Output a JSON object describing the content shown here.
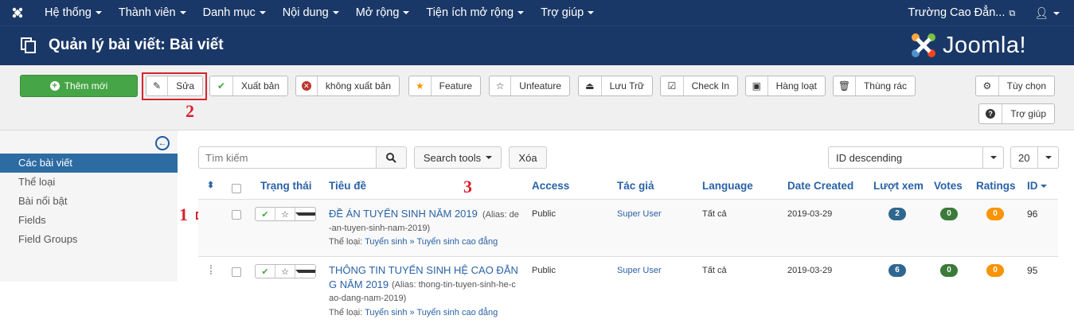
{
  "topbar": {
    "menu": [
      "Hệ thống",
      "Thành viên",
      "Danh mục",
      "Nội dung",
      "Mở rộng",
      "Tiện ích mở rộng",
      "Trợ giúp"
    ],
    "site_name": "Trường Cao Đẳn...",
    "user_icon": "user-icon"
  },
  "header": {
    "title": "Quản lý bài viết: Bài viết",
    "brand": "Joomla!"
  },
  "toolbar": {
    "new_label": "Thêm mới",
    "edit_label": "Sửa",
    "publish_label": "Xuất bản",
    "unpublish_label": "không xuất bản",
    "feature_label": "Feature",
    "unfeature_label": "Unfeature",
    "archive_label": "Lưu Trữ",
    "checkin_label": "Check In",
    "batch_label": "Hàng loạt",
    "trash_label": "Thùng rác",
    "options_label": "Tùy chọn",
    "help_label": "Trợ giúp"
  },
  "annotations": [
    "1",
    "2",
    "3"
  ],
  "sidebar": {
    "items": [
      "Các bài viết",
      "Thể loại",
      "Bài nổi bật",
      "Fields",
      "Field Groups"
    ]
  },
  "filters": {
    "search_placeholder": "Tìm kiếm",
    "search_tools_label": "Search tools",
    "clear_label": "Xóa",
    "ordering": "ID descending",
    "limit": "20"
  },
  "table": {
    "headers": {
      "status": "Trạng thái",
      "title": "Tiêu đề",
      "access": "Access",
      "author": "Tác giả",
      "language": "Language",
      "date": "Date Created",
      "hits": "Lượt xem",
      "votes": "Votes",
      "ratings": "Ratings",
      "id": "ID"
    },
    "category_label": "Thể loại:",
    "rows": [
      {
        "title_line1": "ĐỀ ÁN TUYỂN SINH NĂM 2019",
        "alias_line1": "(Alias: de",
        "alias_line2": "-an-tuyen-sinh-nam-2019)",
        "category": "Tuyển sinh » Tuyển sinh cao đẳng",
        "access": "Public",
        "author": "Super User",
        "language": "Tất cả",
        "date": "2019-03-29",
        "hits": "2",
        "votes": "0",
        "ratings": "0",
        "id": "96"
      },
      {
        "title_line1": "THÔNG TIN TUYỂN SINH HỆ CAO ĐẲN",
        "title_line2": "G NĂM 2019",
        "alias_line1": "(Alias: thong-tin-tuyen-sinh-he-c",
        "alias_line2": "ao-dang-nam-2019)",
        "category": "Tuyển sinh » Tuyển sinh cao đẳng",
        "access": "Public",
        "author": "Super User",
        "language": "Tất cả",
        "date": "2019-03-29",
        "hits": "6",
        "votes": "0",
        "ratings": "0",
        "id": "95"
      }
    ]
  },
  "colors": {
    "nav_bg": "#1a3867",
    "new_button": "#46a546",
    "annotation_red": "#d9232e",
    "hits_badge": "#2f6690",
    "votes_badge": "#3a7a3a",
    "ratings_badge": "#f89406"
  }
}
